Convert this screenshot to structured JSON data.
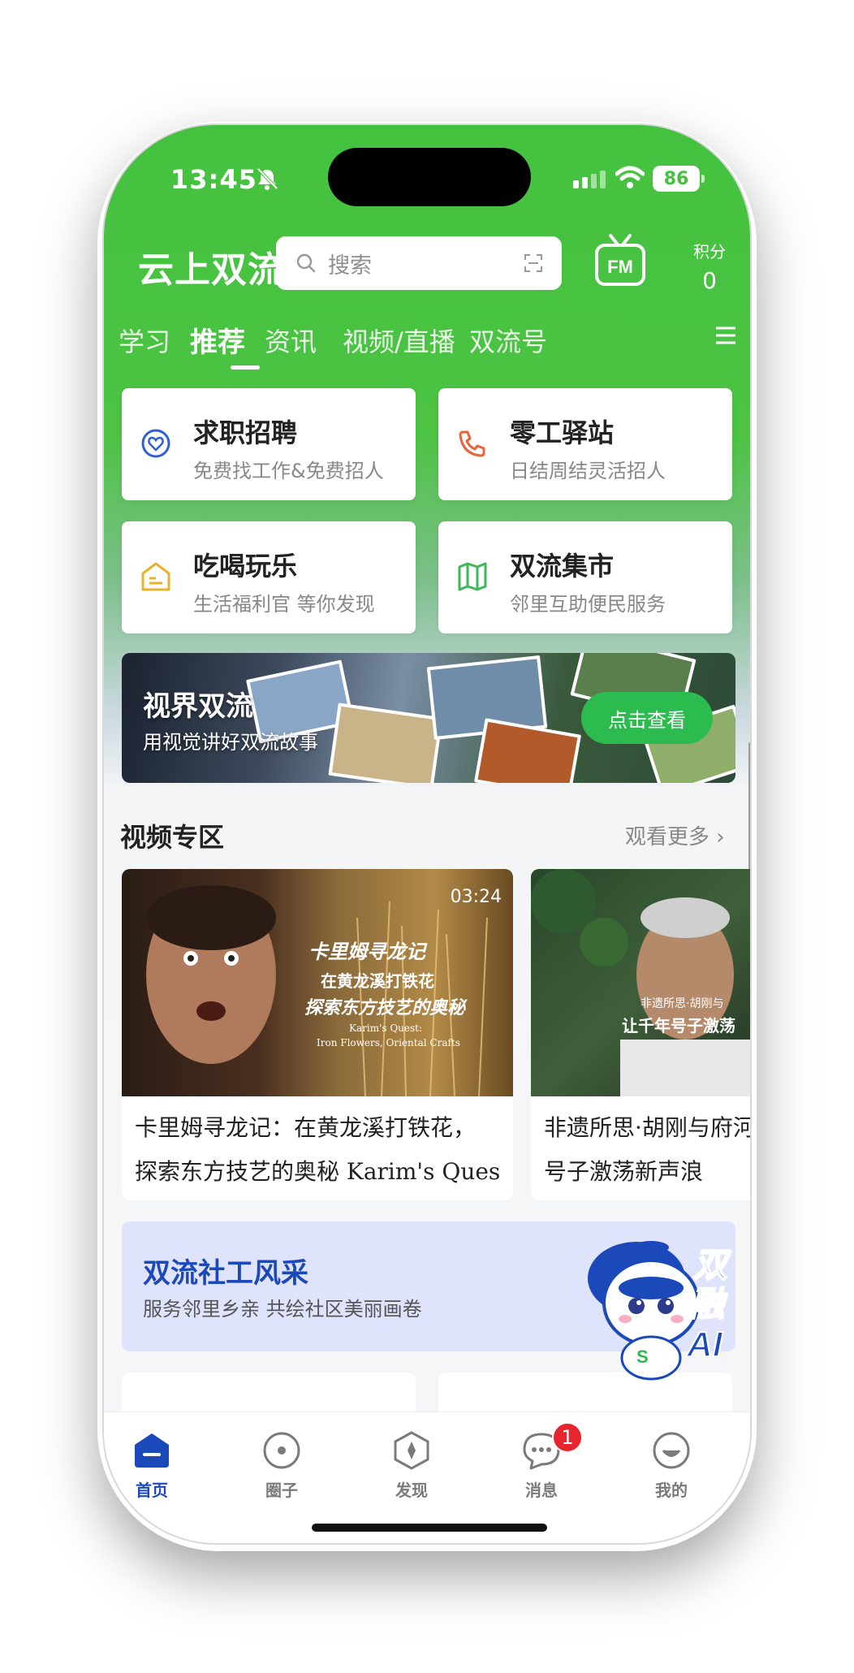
{
  "status_bar": {
    "time": "13:45",
    "battery": "86"
  },
  "header": {
    "app_title": "云上双流",
    "search_placeholder": "搜索",
    "fm_label": "FM",
    "points_label": "积分",
    "points_value": "0"
  },
  "tabs": [
    "学习",
    "推荐",
    "资讯",
    "视频/直播",
    "双流号"
  ],
  "services": [
    {
      "title": "求职招聘",
      "subtitle": "免费找工作&免费招人",
      "icon": "heart-chat-icon",
      "color": "#2f5fd8"
    },
    {
      "title": "零工驿站",
      "subtitle": "日结周结灵活招人",
      "icon": "phone-icon",
      "color": "#e8643a"
    },
    {
      "title": "吃喝玩乐",
      "subtitle": "生活福利官 等你发现",
      "icon": "shop-icon",
      "color": "#e8b22a"
    },
    {
      "title": "双流集市",
      "subtitle": "邻里互助便民服务",
      "icon": "map-icon",
      "color": "#3fb65a"
    }
  ],
  "banner": {
    "title": "视界双流",
    "subtitle": "用视觉讲好双流故事",
    "button": "点击查看"
  },
  "video_section": {
    "title": "视频专区",
    "more": "观看更多",
    "videos": [
      {
        "line1": "卡里姆寻龙记：在黄龙溪打铁花，",
        "line2": "探索东方技艺的奥秘 Karim's Ques",
        "duration": "03:24",
        "overlay1": "卡里姆寻龙记",
        "overlay2": "在黄龙溪打铁花",
        "overlay3": "探索东方技艺的奥秘",
        "overlay4": "Karim's Quest:",
        "overlay5": "Iron Flowers, Oriental Crafts"
      },
      {
        "line1": "非遗所思·胡刚与府河",
        "line2": "号子激荡新声浪",
        "overlay1": "非遗所思·胡刚与",
        "overlay2": "让千年号子激荡"
      }
    ]
  },
  "social_banner": {
    "title": "双流社工风采",
    "subtitle": "服务邻里乡亲  共绘社区美丽画卷"
  },
  "ai_badge": {
    "line1": "双",
    "line2": "融",
    "line3": "AI"
  },
  "nav": {
    "items": [
      {
        "label": "首页",
        "icon": "home-icon",
        "active": true
      },
      {
        "label": "圈子",
        "icon": "circle-icon"
      },
      {
        "label": "发现",
        "icon": "compass-icon"
      },
      {
        "label": "消息",
        "icon": "message-icon",
        "badge": "1"
      },
      {
        "label": "我的",
        "icon": "profile-icon"
      }
    ]
  },
  "colors": {
    "brand_green": "#44c23f",
    "accent_blue": "#1c49b9",
    "badge_red": "#e8252e"
  }
}
